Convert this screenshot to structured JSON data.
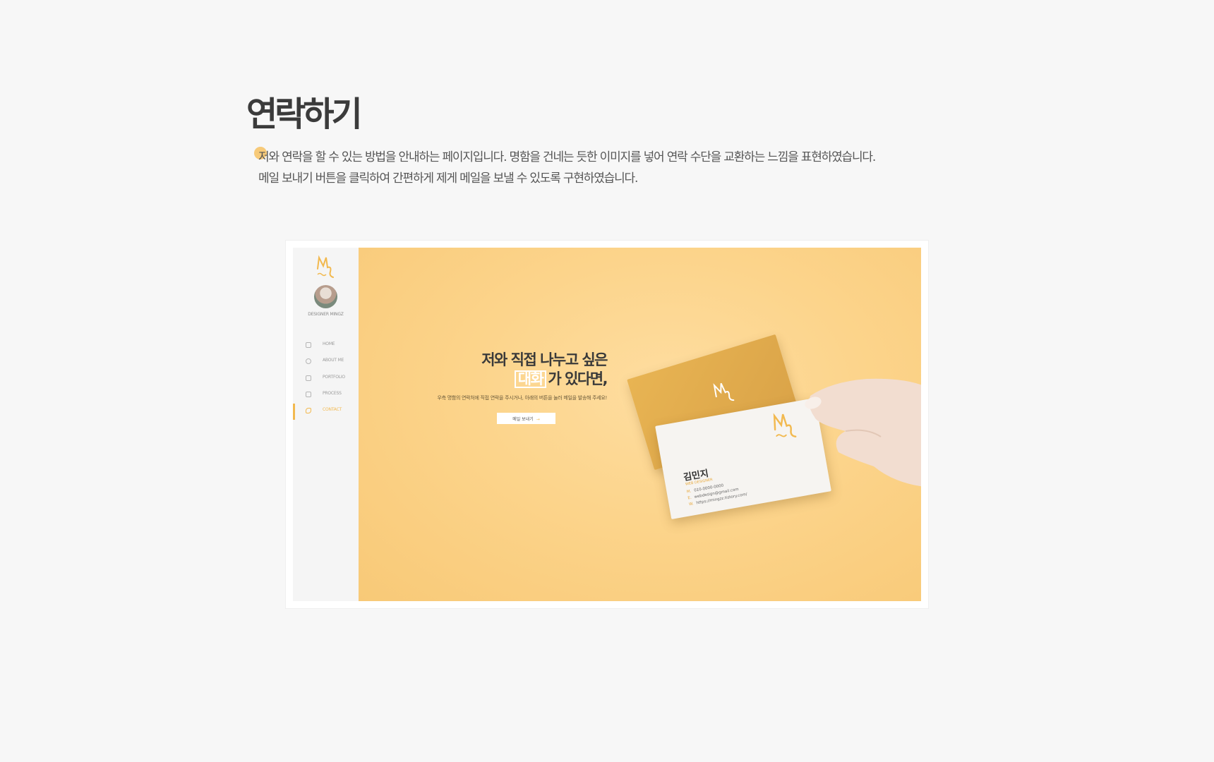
{
  "page": {
    "title": "연락하기",
    "description_line1": "저와 연락을 할 수 있는 방법을 안내하는 페이지입니다. 명함을 건네는 듯한 이미지를 넣어 연락 수단을 교환하는 느낌을 표현하였습니다.",
    "description_line2": "메일 보내기 버튼을 클릭하여 간편하게 제게 메일을 보낼 수 있도록 구현하였습니다."
  },
  "screenshot": {
    "sidebar": {
      "name": "DESIGNER MINGZ",
      "nav": [
        {
          "label": "HOME",
          "icon": "home-icon"
        },
        {
          "label": "ABOUT ME",
          "icon": "user-icon"
        },
        {
          "label": "PORTFOLIO",
          "icon": "folder-icon"
        },
        {
          "label": "PROCESS",
          "icon": "process-icon"
        },
        {
          "label": "CONTACT",
          "icon": "phone-icon",
          "active": true
        }
      ]
    },
    "hero": {
      "line1": "저와 직접 나누고 싶은",
      "highlight": "대화",
      "line2_rest": "가 있다면,",
      "sub": "우측 명함의 연락처에 직접 연락을 주시거나, 아래의 버튼을 눌러 메일을 발송해 주세요!",
      "button_label": "메일 보내기",
      "button_arrow": "→"
    },
    "card": {
      "name": "김민지",
      "role": "WEB DESIGNER",
      "lines": [
        {
          "key": "M.",
          "value": "010-0000-0000"
        },
        {
          "key": "E.",
          "value": "webdesign@gmail.com"
        },
        {
          "key": "W.",
          "value": "https://mingzz.tistory.com/"
        }
      ]
    },
    "accent_color": "#f2b94f",
    "background_color": "#fcd48b"
  }
}
